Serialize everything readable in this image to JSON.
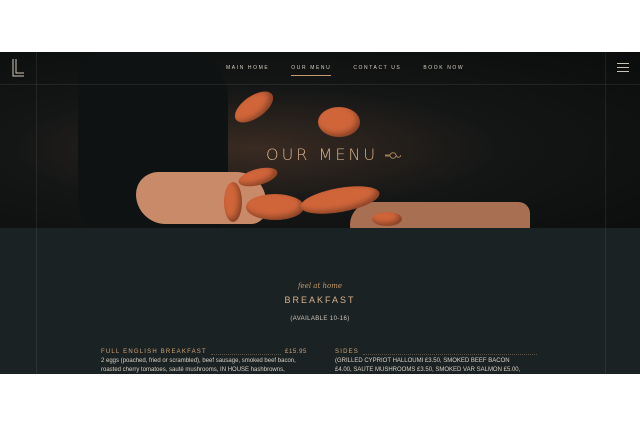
{
  "nav": {
    "items": [
      {
        "label": "MAIN HOME",
        "active": false
      },
      {
        "label": "OUR MENU",
        "active": true
      },
      {
        "label": "CONTACT US",
        "active": false
      },
      {
        "label": "BOOK NOW",
        "active": false
      }
    ]
  },
  "hero": {
    "title": "OUR MENU"
  },
  "menu": {
    "script_label": "feel at home",
    "section_title": "BREAKFAST",
    "section_note": "(AVAILABLE 10-16)",
    "items": [
      {
        "name": "FULL ENGLISH BREAKFAST",
        "price": "£15.95",
        "description_line1": "2 eggs (poached, fried or scrambled), beef sausage, smoked beef bacon,",
        "description_line2": "roasted cherry tomatoes, sauté mushrooms, IN HOUSE hashbrowns,"
      },
      {
        "name": "SIDES",
        "price": "",
        "description_line1": "(GRILLED CYPRIOT HALLOUMI £3.50, SMOKED BEEF BACON",
        "description_line2": "£4.00, SAUTE MUSHROOMS £3.50, SMOKED VAR SALMON £5.00,"
      }
    ]
  },
  "colors": {
    "accent": "#d6b08a",
    "background": "#1b2224"
  },
  "icons": [
    "logo-icon",
    "hamburger-menu-icon",
    "ornament-icon"
  ]
}
